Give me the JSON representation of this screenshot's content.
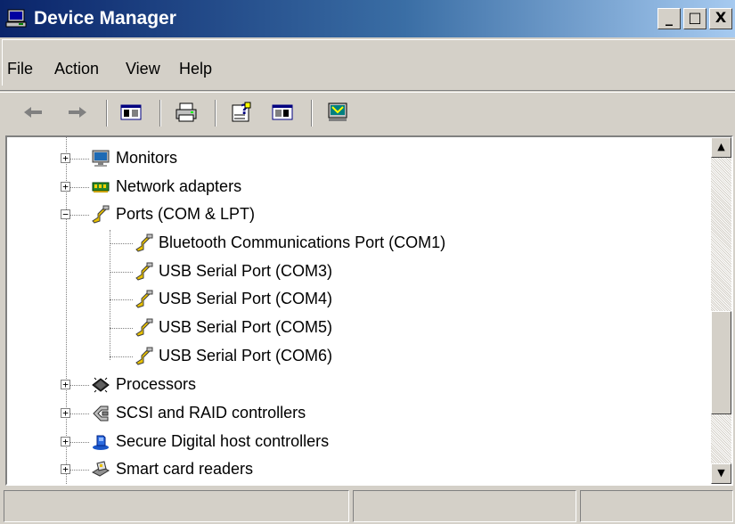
{
  "window": {
    "title": "Device Manager",
    "buttons": [
      "_",
      "□",
      "X"
    ]
  },
  "menu": [
    "File",
    "Action",
    "View",
    "Help"
  ],
  "toolbar": {
    "buttons": [
      "back-arrow-icon",
      "forward-arrow-icon",
      "show-hide-tree-icon",
      "print-icon",
      "help-icon",
      "properties-icon",
      "scan-hardware-icon"
    ]
  },
  "tree": {
    "items": [
      {
        "label": "Monitors",
        "icon": "monitor-icon",
        "expander": "+"
      },
      {
        "label": "Network adapters",
        "icon": "network-adapter-icon",
        "expander": "+"
      },
      {
        "label": "Ports (COM & LPT)",
        "icon": "port-icon",
        "expander": "−"
      },
      {
        "label": "Bluetooth Communications Port (COM1)",
        "icon": "port-icon",
        "child": true
      },
      {
        "label": "USB Serial Port (COM3)",
        "icon": "port-icon",
        "child": true
      },
      {
        "label": "USB Serial Port (COM4)",
        "icon": "port-icon",
        "child": true
      },
      {
        "label": "USB Serial Port (COM5)",
        "icon": "port-icon",
        "child": true
      },
      {
        "label": "USB Serial Port (COM6)",
        "icon": "port-icon",
        "child": true
      },
      {
        "label": "Processors",
        "icon": "processor-icon",
        "expander": "+"
      },
      {
        "label": "SCSI and RAID controllers",
        "icon": "scsi-controller-icon",
        "expander": "+"
      },
      {
        "label": "Secure Digital host controllers",
        "icon": "sd-host-icon",
        "expander": "+"
      },
      {
        "label": "Smart card readers",
        "icon": "smart-card-reader-icon",
        "expander": "+"
      }
    ]
  },
  "scrollbar": {
    "up": "▲",
    "down": "▼"
  },
  "statusbar": {
    "panes": [
      "",
      "",
      ""
    ]
  },
  "colors": {
    "titlebar_start": "#0a246a",
    "titlebar_end": "#a6caf0",
    "face": "#d4d0c8"
  }
}
